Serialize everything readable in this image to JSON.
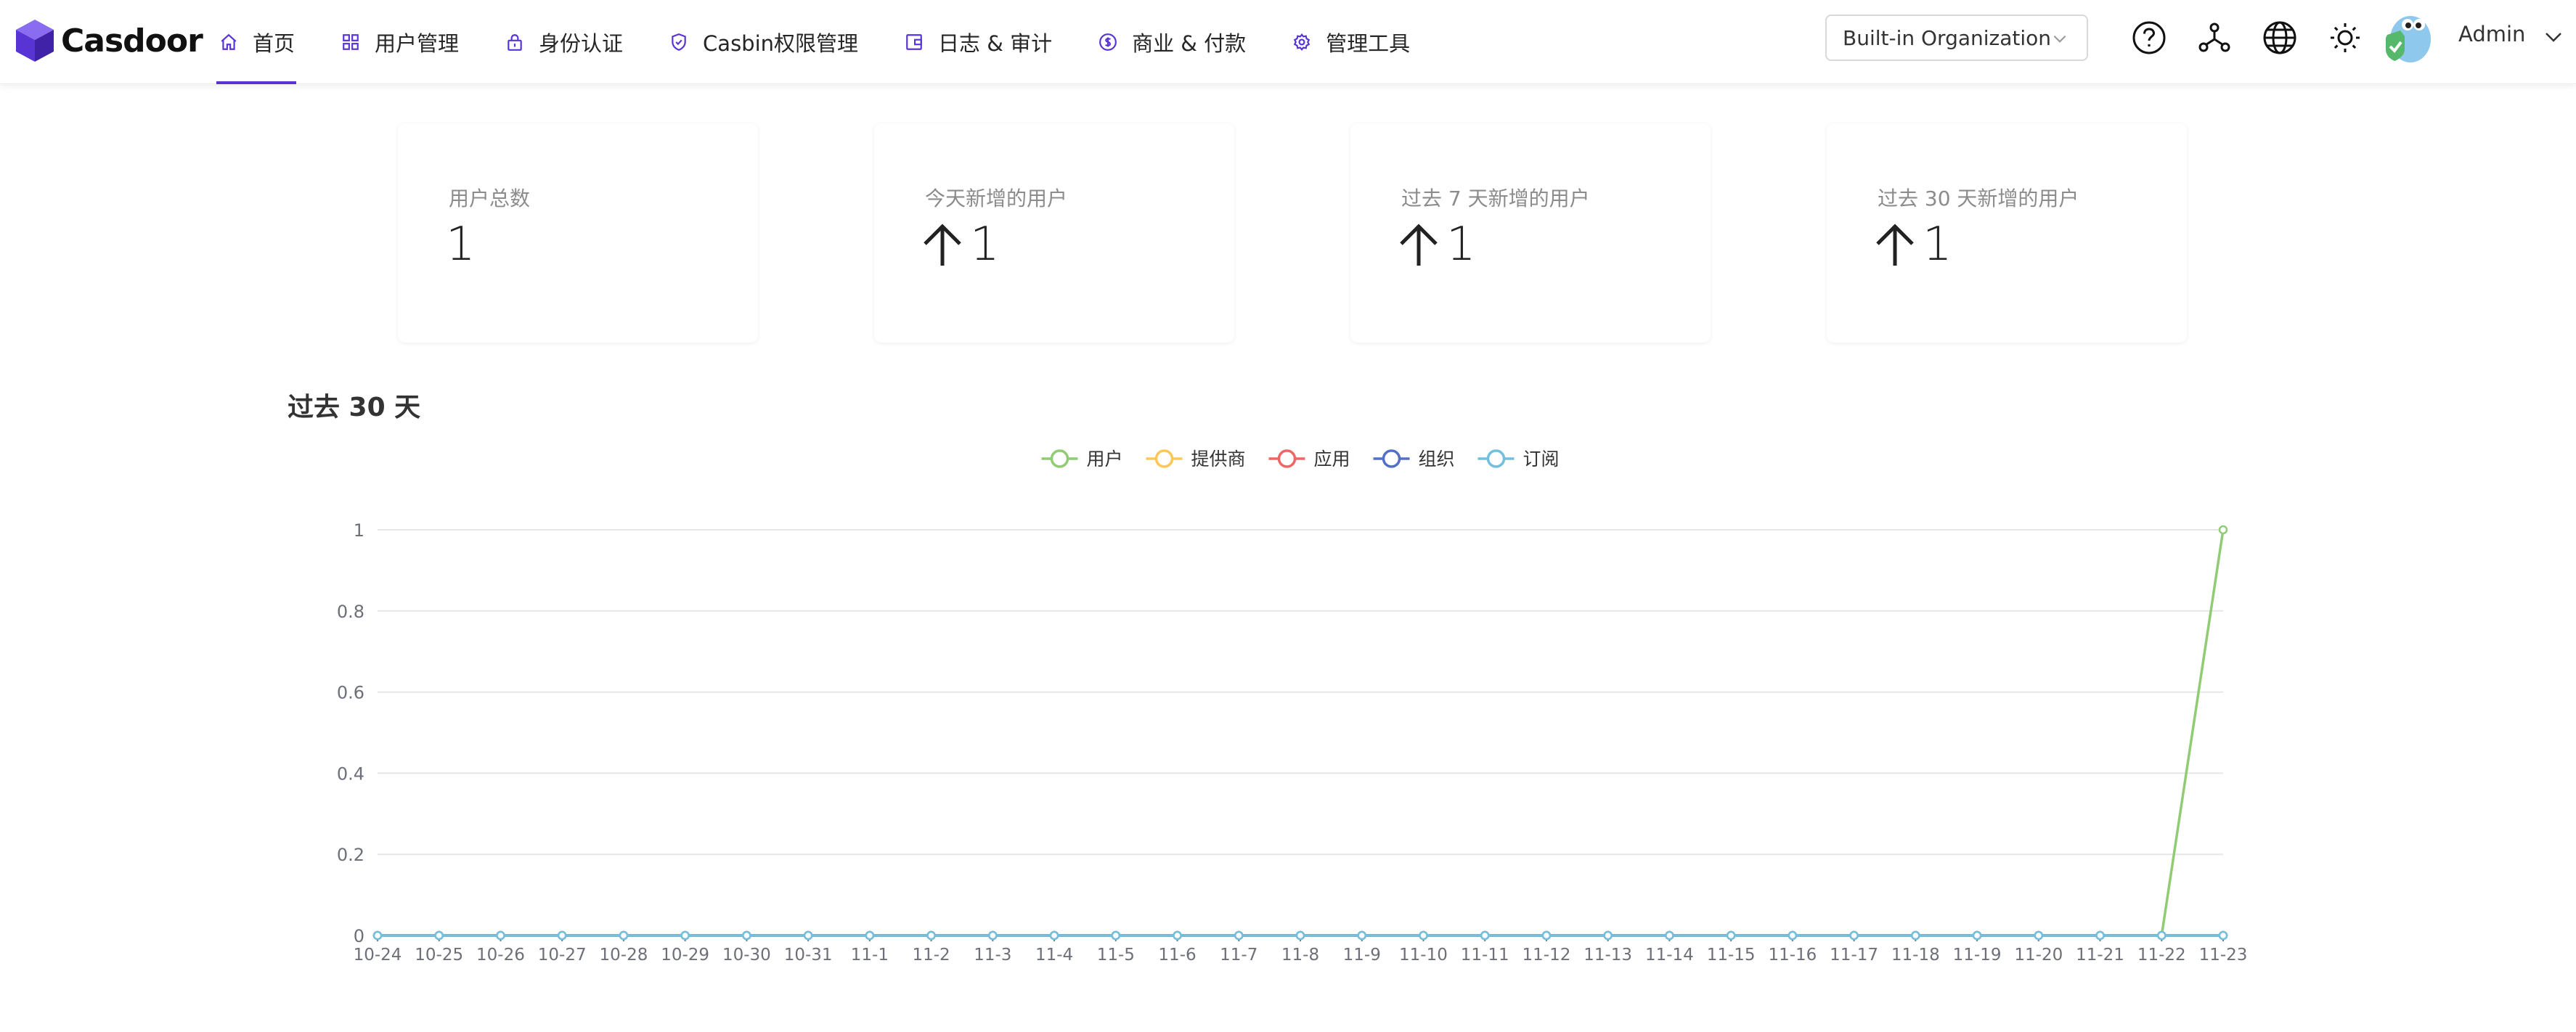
{
  "app": {
    "brand": "Casdoor"
  },
  "nav": {
    "items": [
      {
        "label": "首页",
        "icon": "home-icon",
        "active": true
      },
      {
        "label": "用户管理",
        "icon": "appstore-icon",
        "active": false
      },
      {
        "label": "身份认证",
        "icon": "lock-icon",
        "active": false
      },
      {
        "label": "Casbin权限管理",
        "icon": "shield-check-icon",
        "active": false
      },
      {
        "label": "日志 & 审计",
        "icon": "wallet-icon",
        "active": false
      },
      {
        "label": "商业 & 付款",
        "icon": "dollar-circle-icon",
        "active": false
      },
      {
        "label": "管理工具",
        "icon": "gear-icon",
        "active": false
      }
    ]
  },
  "header": {
    "organization": "Built-in Organization",
    "user_name": "Admin"
  },
  "colors": {
    "accent": "#5734d3",
    "users": "#91cc75",
    "providers": "#fac858",
    "applications": "#ee6666",
    "organizations": "#5470c6",
    "subscriptions": "#73c0de"
  },
  "stats": [
    {
      "title": "用户总数",
      "value": "1",
      "arrow": false
    },
    {
      "title": "今天新增的用户",
      "value": "1",
      "arrow": true
    },
    {
      "title": "过去 7 天新增的用户",
      "value": "1",
      "arrow": true
    },
    {
      "title": "过去 30 天新增的用户",
      "value": "1",
      "arrow": true
    }
  ],
  "section": {
    "title": "过去 30 天"
  },
  "chart_data": {
    "type": "line",
    "title": "",
    "xlabel": "",
    "ylabel": "",
    "ylim": [
      0,
      1
    ],
    "yticks": [
      0,
      0.2,
      0.4,
      0.6,
      0.8,
      1
    ],
    "grid": true,
    "legend_position": "top-center",
    "x": [
      "10-24",
      "10-25",
      "10-26",
      "10-27",
      "10-28",
      "10-29",
      "10-30",
      "10-31",
      "11-1",
      "11-2",
      "11-3",
      "11-4",
      "11-5",
      "11-6",
      "11-7",
      "11-8",
      "11-9",
      "11-10",
      "11-11",
      "11-12",
      "11-13",
      "11-14",
      "11-15",
      "11-16",
      "11-17",
      "11-18",
      "11-19",
      "11-20",
      "11-21",
      "11-22",
      "11-23"
    ],
    "series": [
      {
        "name": "用户",
        "color": "#91cc75",
        "values": [
          0,
          0,
          0,
          0,
          0,
          0,
          0,
          0,
          0,
          0,
          0,
          0,
          0,
          0,
          0,
          0,
          0,
          0,
          0,
          0,
          0,
          0,
          0,
          0,
          0,
          0,
          0,
          0,
          0,
          0,
          1
        ]
      },
      {
        "name": "提供商",
        "color": "#fac858",
        "values": [
          0,
          0,
          0,
          0,
          0,
          0,
          0,
          0,
          0,
          0,
          0,
          0,
          0,
          0,
          0,
          0,
          0,
          0,
          0,
          0,
          0,
          0,
          0,
          0,
          0,
          0,
          0,
          0,
          0,
          0,
          0
        ]
      },
      {
        "name": "应用",
        "color": "#ee6666",
        "values": [
          0,
          0,
          0,
          0,
          0,
          0,
          0,
          0,
          0,
          0,
          0,
          0,
          0,
          0,
          0,
          0,
          0,
          0,
          0,
          0,
          0,
          0,
          0,
          0,
          0,
          0,
          0,
          0,
          0,
          0,
          0
        ]
      },
      {
        "name": "组织",
        "color": "#5470c6",
        "values": [
          0,
          0,
          0,
          0,
          0,
          0,
          0,
          0,
          0,
          0,
          0,
          0,
          0,
          0,
          0,
          0,
          0,
          0,
          0,
          0,
          0,
          0,
          0,
          0,
          0,
          0,
          0,
          0,
          0,
          0,
          0
        ]
      },
      {
        "name": "订阅",
        "color": "#73c0de",
        "values": [
          0,
          0,
          0,
          0,
          0,
          0,
          0,
          0,
          0,
          0,
          0,
          0,
          0,
          0,
          0,
          0,
          0,
          0,
          0,
          0,
          0,
          0,
          0,
          0,
          0,
          0,
          0,
          0,
          0,
          0,
          0
        ]
      }
    ]
  }
}
